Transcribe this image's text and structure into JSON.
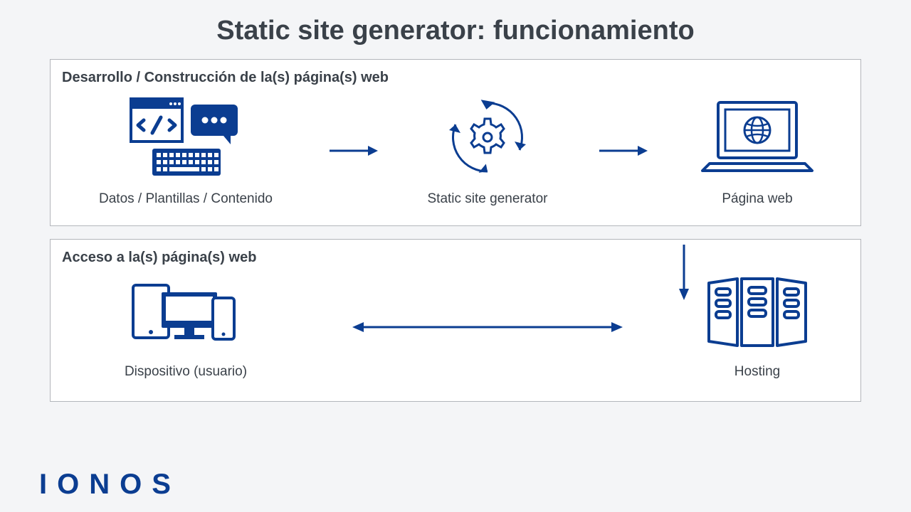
{
  "title": "Static site generator: funcionamiento",
  "panel1": {
    "heading": "Desarrollo / Construcción de la(s) página(s) web",
    "step1": "Datos / Plantillas / Contenido",
    "step2": "Static site generator",
    "step3": "Página web"
  },
  "panel2": {
    "heading": "Acceso a la(s) página(s) web",
    "left": "Dispositivo (usuario)",
    "right": "Hosting"
  },
  "brand": "IONOS",
  "colors": {
    "primary": "#0b3d91",
    "text": "#3a4149"
  }
}
